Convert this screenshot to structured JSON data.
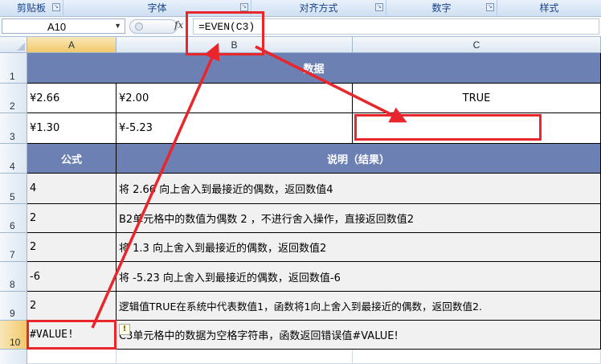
{
  "ribbon": {
    "groups": [
      "剪贴板",
      "字体",
      "对齐方式",
      "数字",
      "样式"
    ]
  },
  "formula_bar": {
    "name_box": "A10",
    "fx_label": "fx",
    "formula": "=EVEN(C3)"
  },
  "columns": [
    "A",
    "B",
    "C"
  ],
  "rows": [
    "1",
    "2",
    "3",
    "4",
    "5",
    "6",
    "7",
    "8",
    "9",
    "10"
  ],
  "sheet": {
    "title": "数据",
    "r2": {
      "a": "¥2.66",
      "b": "¥2.00",
      "c": "TRUE"
    },
    "r3": {
      "a": "¥1.30",
      "b": "¥-5.23",
      "c": ""
    },
    "header": {
      "formula": "公式",
      "desc": "说明（结果）"
    },
    "results": [
      {
        "value": "4",
        "desc": "将 2.66 向上舍入到最接近的偶数，返回数值4"
      },
      {
        "value": "2",
        "desc": "B2单元格中的数值为偶数 2 ，不进行舍入操作，直接返回数值2"
      },
      {
        "value": "2",
        "desc": "将 1.3 向上舍入到最接近的偶数，返回数值2"
      },
      {
        "value": "-6",
        "desc": "将 -5.23 向上舍入到最接近的偶数，返回数值-6"
      },
      {
        "value": "2",
        "desc": "逻辑值TRUE在系统中代表数值1，函数将1向上舍入到最接近的偶数，返回数值2."
      },
      {
        "value": "#VALUE!",
        "desc": "C3单元格中的数据为空格字符串，函数返回错误值#VALUE!"
      }
    ]
  },
  "colors": {
    "header_band": "#6c80b3",
    "annotation": "#e8262b"
  }
}
